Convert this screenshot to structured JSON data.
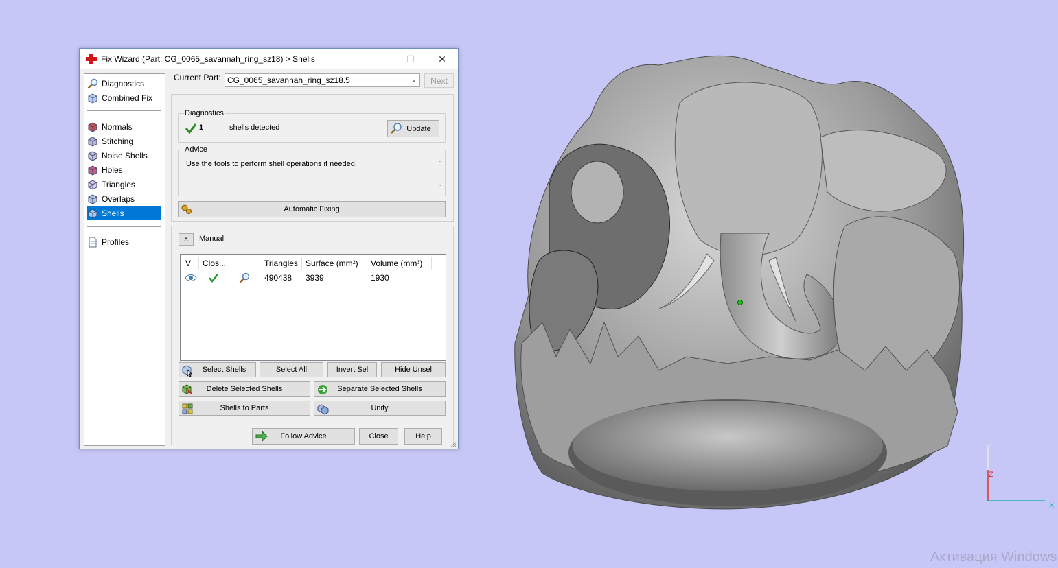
{
  "dialog": {
    "title": "Fix Wizard (Part: CG_0065_savannah_ring_sz18) > Shells",
    "window_buttons": [
      "minimize-icon",
      "maximize-icon",
      "close-icon"
    ]
  },
  "nav": {
    "top_items": [
      {
        "label": "Diagnostics",
        "icon": "magnifier-icon"
      },
      {
        "label": "Combined Fix",
        "icon": "cube-icon"
      }
    ],
    "fix_items": [
      {
        "label": "Normals",
        "icon": "cube-normals-icon"
      },
      {
        "label": "Stitching",
        "icon": "cube-stitching-icon"
      },
      {
        "label": "Noise Shells",
        "icon": "cube-noise-icon"
      },
      {
        "label": "Holes",
        "icon": "cube-holes-icon"
      },
      {
        "label": "Triangles",
        "icon": "cube-triangles-icon"
      },
      {
        "label": "Overlaps",
        "icon": "cube-overlaps-icon"
      },
      {
        "label": "Shells",
        "icon": "cube-shells-icon",
        "selected": true
      }
    ],
    "bottom_items": [
      {
        "label": "Profiles",
        "icon": "document-icon"
      }
    ]
  },
  "current_part": {
    "label": "Current Part:",
    "value": "CG_0065_savannah_ring_sz18.5",
    "next_label": "Next"
  },
  "diagnostics": {
    "title": "Diagnostics",
    "count": "1",
    "text": "shells detected",
    "update_label": "Update"
  },
  "advice": {
    "title": "Advice",
    "text": "Use the tools to perform shell operations if needed."
  },
  "automatic_fixing_label": "Automatic Fixing",
  "manual": {
    "title": "Manual",
    "columns": [
      "V",
      "Clos...",
      "",
      "Triangles",
      "Surface (mm²)",
      "Volume (mm³)"
    ],
    "rows": [
      {
        "visible_icon": "eye-icon",
        "closed_icon": "check-icon",
        "zoom_icon": "magnifier-icon",
        "triangles": "490438",
        "surface": "3939",
        "volume": "1930"
      }
    ]
  },
  "buttons": {
    "select_shells": "Select Shells",
    "select_all": "Select All",
    "invert_sel": "Invert Sel",
    "hide_unsel": "Hide Unsel",
    "delete_selected": "Delete Selected Shells",
    "separate_selected": "Separate Selected Shells",
    "shells_to_parts": "Shells to Parts",
    "unify": "Unify",
    "follow_advice": "Follow Advice",
    "close": "Close",
    "help": "Help"
  },
  "axes": {
    "y": "Y",
    "z": "Z",
    "x": "X"
  },
  "watermark": "Активация Windows",
  "colors": {
    "background": "#c7c7f7",
    "selection": "#0078d7",
    "model": "#9a9a9a"
  }
}
